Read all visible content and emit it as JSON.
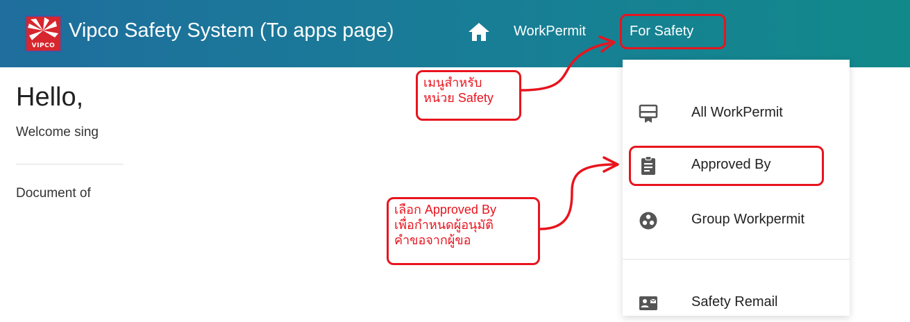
{
  "header": {
    "logo_text": "VIPCO",
    "app_title": "Vipco Safety System (To apps page)",
    "nav": {
      "workpermit": "WorkPermit",
      "for_safety": "For Safety"
    }
  },
  "main": {
    "greeting": "Hello,",
    "welcome": "Welcome sing",
    "document_of": "Document of"
  },
  "menu": {
    "items": [
      {
        "label": "All WorkPermit",
        "icon": "certificate-icon"
      },
      {
        "label": "Approved By",
        "icon": "clipboard-icon"
      },
      {
        "label": "Group Workpermit",
        "icon": "group-icon"
      },
      {
        "label": "Safety Remail",
        "icon": "contact-mail-icon"
      }
    ]
  },
  "annotations": {
    "safety_menu_note_line1": "เมนูสำหรับ",
    "safety_menu_note_line2": "หน่วย Safety",
    "approved_note_line1": "เลือก Approved By",
    "approved_note_line2": "เพื่อกำหนดผู้อนุมัติ",
    "approved_note_line3": "คำขอจากผู้ขอ"
  },
  "colors": {
    "toolbar_start": "#1f6e9d",
    "toolbar_end": "#11898a",
    "annotation_red": "#e8141e",
    "logo_red": "#d7262d"
  }
}
